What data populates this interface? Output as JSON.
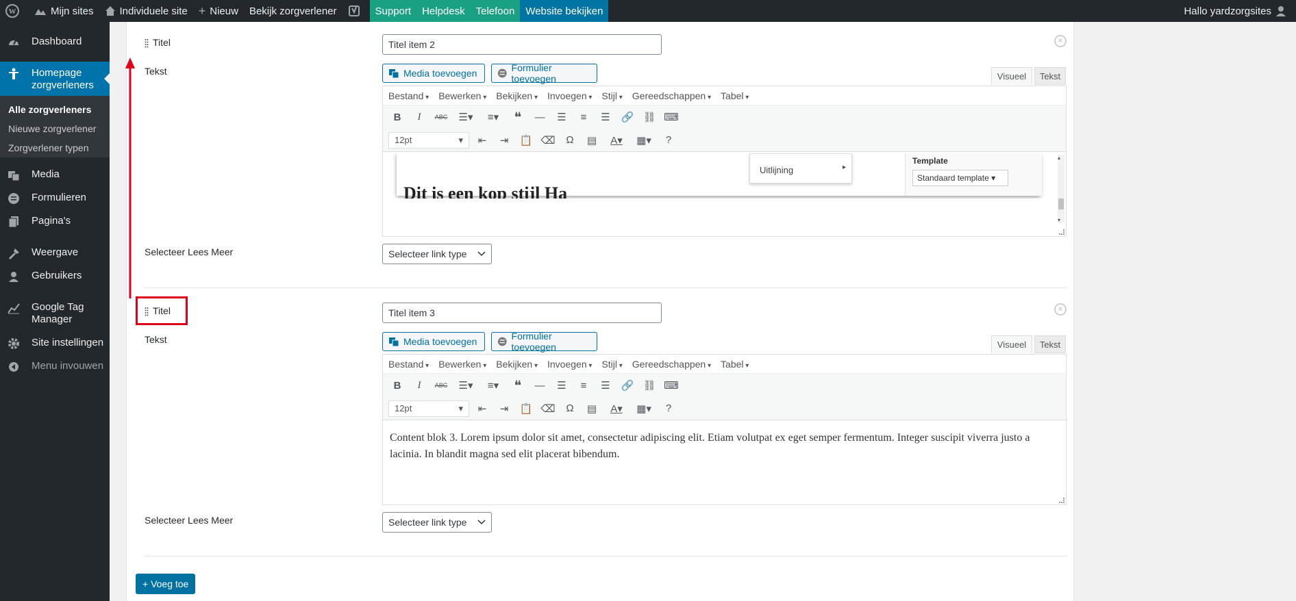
{
  "adminbar": {
    "my_sites": "Mijn sites",
    "individual_site": "Individuele site",
    "new": "Nieuw",
    "view_provider": "Bekijk zorgverlener",
    "support": "Support",
    "helpdesk": "Helpdesk",
    "phone": "Telefoon",
    "view_site": "Website bekijken",
    "greeting": "Hallo yardzorgsites"
  },
  "sidebar": {
    "items": [
      {
        "label": "Dashboard",
        "icon": "dashboard-icon"
      },
      {
        "label": "Homepage zorgverleners",
        "icon": "person-icon",
        "active": true
      },
      {
        "label": "Media",
        "icon": "media-icon"
      },
      {
        "label": "Formulieren",
        "icon": "forms-icon"
      },
      {
        "label": "Pagina's",
        "icon": "pages-icon"
      },
      {
        "label": "Weergave",
        "icon": "appearance-icon"
      },
      {
        "label": "Gebruikers",
        "icon": "users-icon"
      },
      {
        "label": "Google Tag Manager",
        "icon": "chart-icon"
      },
      {
        "label": "Site instellingen",
        "icon": "gear-icon"
      },
      {
        "label": "Menu invouwen",
        "icon": "collapse-icon"
      }
    ],
    "submenu": [
      "Alle zorgverleners",
      "Nieuwe zorgverlener",
      "Zorgverlener typen"
    ]
  },
  "item2": {
    "title_label": "Titel",
    "title_value": "Titel item 2",
    "text_label": "Tekst",
    "media_btn": "Media toevoegen",
    "form_btn": "Formulier toevoegen",
    "tab_visual": "Visueel",
    "tab_text": "Tekst",
    "font_size": "12pt",
    "embedded": {
      "menu_item": "Uitlijning",
      "template_label": "Template",
      "template_value": "Standaard template",
      "partial_heading": "Dit is een kop stijl Ha"
    },
    "read_more_label": "Selecteer Lees Meer",
    "read_more_select": "Selecteer link type"
  },
  "item3": {
    "title_label": "Titel",
    "title_value": "Titel item 3",
    "text_label": "Tekst",
    "media_btn": "Media toevoegen",
    "form_btn": "Formulier toevoegen",
    "tab_visual": "Visueel",
    "tab_text": "Tekst",
    "font_size": "12pt",
    "content": "Content blok 3. Lorem ipsum dolor sit amet, consectetur adipiscing elit. Etiam volutpat ex eget semper fermentum. Integer suscipit viverra justo a lacinia. In blandit magna sed elit placerat bibendum.",
    "read_more_label": "Selecteer Lees Meer",
    "read_more_select": "Selecteer link type"
  },
  "editor_menu": [
    "Bestand",
    "Bewerken",
    "Bekijken",
    "Invoegen",
    "Stijl",
    "Gereedschappen",
    "Tabel"
  ],
  "add_button": "+ Voeg toe",
  "colors": {
    "accent": "#0073aa",
    "annotation": "#e0001a",
    "adminbar": "#23282d"
  }
}
